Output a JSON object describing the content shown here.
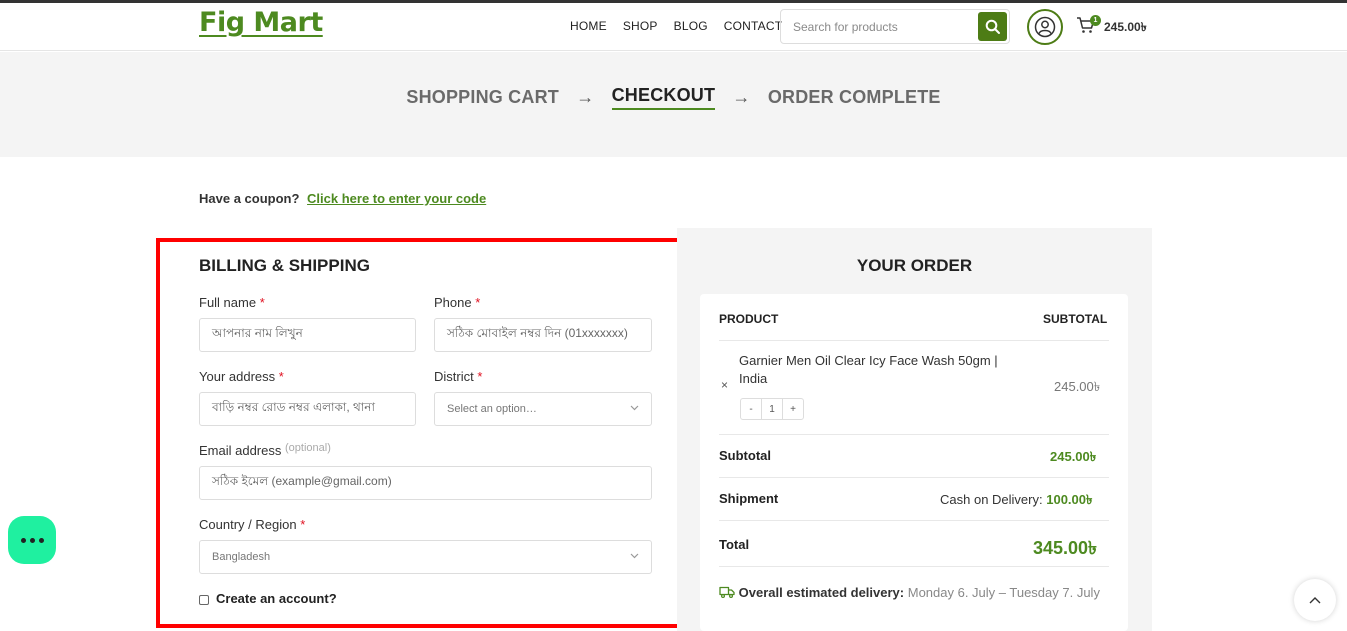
{
  "header": {
    "logo": "Fig Mart",
    "nav": [
      "HOME",
      "SHOP",
      "BLOG",
      "CONTACT"
    ],
    "search_placeholder": "Search for products",
    "cart_count": "1",
    "cart_total": "245.00৳"
  },
  "steps": {
    "step1": "SHOPPING CART",
    "arrow": "→",
    "step2": "CHECKOUT",
    "step3": "ORDER COMPLETE"
  },
  "coupon": {
    "text": "Have a coupon?",
    "link": "Click here to enter your code"
  },
  "billing": {
    "title": "BILLING & SHIPPING",
    "required_mark": "*",
    "full_name_label": "Full name",
    "full_name_placeholder": "আপনার নাম লিখুন",
    "phone_label": "Phone",
    "phone_placeholder": "সঠিক মোবাইল নম্বর দিন  (01xxxxxxx)",
    "address_label": "Your address",
    "address_placeholder": "বাড়ি নম্বর রোড নম্বর এলাকা, থানা",
    "district_label": "District",
    "district_value": "Select an option…",
    "email_label": "Email address",
    "email_optional": "(optional)",
    "email_placeholder": "সঠিক ইমেল (example@gmail.com)",
    "country_label": "Country / Region",
    "country_value": "Bangladesh",
    "create_account": "Create an account?"
  },
  "order": {
    "title": "YOUR ORDER",
    "col_product": "PRODUCT",
    "col_subtotal": "SUBTOTAL",
    "item_name": "Garnier Men Oil Clear Icy Face Wash 50gm | India",
    "item_price": "245.00৳",
    "qty_minus": "-",
    "qty_value": "1",
    "qty_plus": "+",
    "remove": "×",
    "subtotal_label": "Subtotal",
    "subtotal_value": "245.00৳",
    "shipment_label": "Shipment",
    "shipment_method": "Cash on Delivery:",
    "shipment_value": "100.00৳",
    "total_label": "Total",
    "total_value": "345.00৳",
    "delivery_label": "Overall estimated delivery:",
    "delivery_value": "Monday 6. July – Tuesday 7. July"
  },
  "colors": {
    "accent": "#4d8a20",
    "highlight_border": "#ff0000",
    "chat_bubble": "#1ff0a0"
  }
}
